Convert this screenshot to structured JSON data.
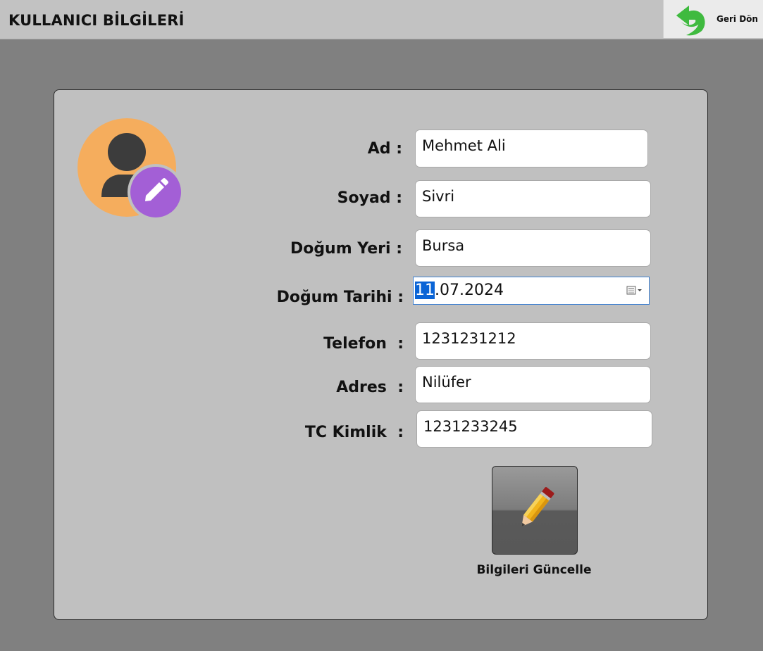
{
  "header": {
    "title": "KULLANICI BİLGİLERİ",
    "back_label": "Geri Dön"
  },
  "form": {
    "first_name": {
      "label": "Ad :",
      "value": "Mehmet Ali"
    },
    "last_name": {
      "label": "Soyad :",
      "value": "Sivri"
    },
    "birth_place": {
      "label": "Doğum Yeri :",
      "value": "Bursa"
    },
    "birth_date": {
      "label": "Doğum Tarihi :",
      "day": "11",
      "rest": ".07.2024"
    },
    "phone": {
      "label": "Telefon  :",
      "value": "1231231212"
    },
    "address": {
      "label": "Adres  :",
      "value": "Nilüfer"
    },
    "tc_id": {
      "label": "TC Kimlik  :",
      "value": "1231233245"
    }
  },
  "actions": {
    "update_label": "Bilgileri Güncelle"
  },
  "icons": {
    "back": "back-arrow-icon",
    "avatar": "user-avatar-icon",
    "avatar_edit": "pencil-edit-icon",
    "calendar": "calendar-dropdown-icon",
    "update": "pencil-icon"
  },
  "colors": {
    "avatar_bg": "#f5ad5d",
    "avatar_edit_bg": "#a35fd6",
    "back_arrow": "#3fba3f",
    "date_selection": "#0a64d6"
  }
}
